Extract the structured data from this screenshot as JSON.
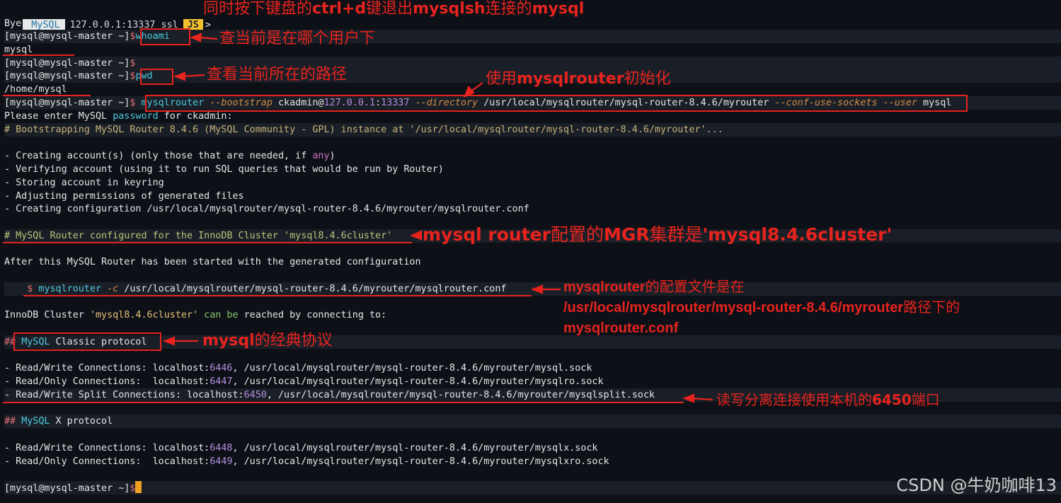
{
  "shell": {
    "mode": "MySQL",
    "connection": "127.0.0.1:13337 ssl",
    "lang": "JS",
    "arrow": ">"
  },
  "prompt": "[mysql@mysql-master ~]",
  "dollar": "$",
  "lines": {
    "bye": "Bye!",
    "cmd_whoami": "whoami",
    "out_whoami": "mysql",
    "cmd_pwd": "pwd",
    "out_pwd": "/home/mysql",
    "bootstrap_cmd": "mysqlrouter",
    "bootstrap_opt1": "--bootstrap",
    "bootstrap_user": "ckadmin@",
    "bootstrap_host": "127.0.0.1",
    "bootstrap_colon": ":",
    "bootstrap_port": "13337",
    "bootstrap_opt2": "--directory",
    "bootstrap_dir": "/usr/local/mysqlrouter/mysql-router-8.4.6/myrouter",
    "bootstrap_opt3": "--conf-use-sockets",
    "bootstrap_opt4": "--user",
    "bootstrap_userval": "mysql",
    "pw_prompt_a": "Please enter MySQL ",
    "pw_prompt_b": "password",
    "pw_prompt_c": " for ckadmin:",
    "bootstrapping": "# Bootstrapping MySQL Router 8.4.6 (MySQL Community - GPL) instance at '/usr/local/mysqlrouter/mysql-router-8.4.6/myrouter'...",
    "step1_a": "- Creating account(s) (only those that are needed, if ",
    "step1_b": "any",
    "step1_c": ")",
    "step2": "- Verifying account (using it to run SQL queries that would be run by Router)",
    "step3": "- Storing account in keyring",
    "step4": "- Adjusting permissions of generated files",
    "step5": "- Creating configuration /usr/local/mysqlrouter/mysql-router-8.4.6/myrouter/mysqlrouter.conf",
    "configured": "# MySQL Router configured for the InnoDB Cluster 'mysql8.4.6cluster'",
    "after": "After this MySQL Router has been started with the generated configuration",
    "start_dollar": "$",
    "start_cmd": "mysqlrouter",
    "start_opt": "-c",
    "start_path": "/usr/local/mysqlrouter/mysql-router-8.4.6/myrouter/mysqlrouter.conf",
    "innodb_a": "InnoDB Cluster ",
    "innodb_b": "'mysql8.4.6cluster'",
    "innodb_c": " can be",
    "innodb_d": " reached by connecting to:",
    "classic_hash": "##",
    "classic_mysql": "MySQL",
    "classic_rest": " Classic protocol",
    "rw_a": "- Read/Write Connections: localhost:",
    "rw_port": "6446",
    "rw_b": ", /usr/local/mysqlrouter/mysql-router-8.4.6/myrouter/mysql.sock",
    "ro_a": "- Read/Only Connections:  localhost:",
    "ro_port": "6447",
    "ro_b": ", /usr/local/mysqlrouter/mysql-router-8.4.6/myrouter/mysqlro.sock",
    "rws_a": "- Read/Write Split Connections: localhost:",
    "rws_port": "6450",
    "rws_b": ", /usr/local/mysqlrouter/mysql-router-8.4.6/myrouter/mysqlsplit.sock",
    "x_hash": "##",
    "x_mysql": "MySQL",
    "x_rest": " X protocol",
    "xrw_a": "- Read/Write Connections: localhost:",
    "xrw_port": "6448",
    "xrw_b": ", /usr/local/mysqlrouter/mysql-router-8.4.6/myrouter/mysqlx.sock",
    "xro_a": "- Read/Only Connections:  localhost:",
    "xro_port": "6449",
    "xro_b": ", /usr/local/mysqlrouter/mysql-router-8.4.6/myrouter/mysqlxro.sock"
  },
  "annotations": {
    "exit_a": "同时按下键盘的",
    "exit_b": "ctrl+d",
    "exit_c": "键退出",
    "exit_d": "mysqlsh",
    "exit_e": "连接的",
    "exit_f": "mysql",
    "whoami": "查当前是在哪个用户下",
    "pwd": "查看当前所在的路径",
    "init_a": "使用",
    "init_b": "mysqlrouter",
    "init_c": "初始化",
    "mgr_a": "mysql router",
    "mgr_b": "配置的",
    "mgr_c": "MGR",
    "mgr_d": "集群是",
    "mgr_e": "'mysql8.4.6cluster'",
    "conf_a": "mysqlrouter",
    "conf_b": "的配置文件是在",
    "conf_c": "/usr/local/mysqlrouter/mysql-router-8.4.6/myrouter",
    "conf_d": "路径下的",
    "conf_e": "mysqlrouter.conf",
    "classic_a": "mysql",
    "classic_b": "的经典协议",
    "split_a": "读写分离连接使用本机的",
    "split_b": "6450",
    "split_c": "端口"
  },
  "watermark": "CSDN @牛奶咖啡13",
  "colors": {
    "background": "#0d1117",
    "annotation": "#e8231e",
    "prompt_dollar": "#e06c75",
    "command": "#4cc9e0",
    "option": "#d08c4a",
    "number": "#b48ede",
    "comment": "#c8b27a",
    "cursor": "#f0a020"
  }
}
